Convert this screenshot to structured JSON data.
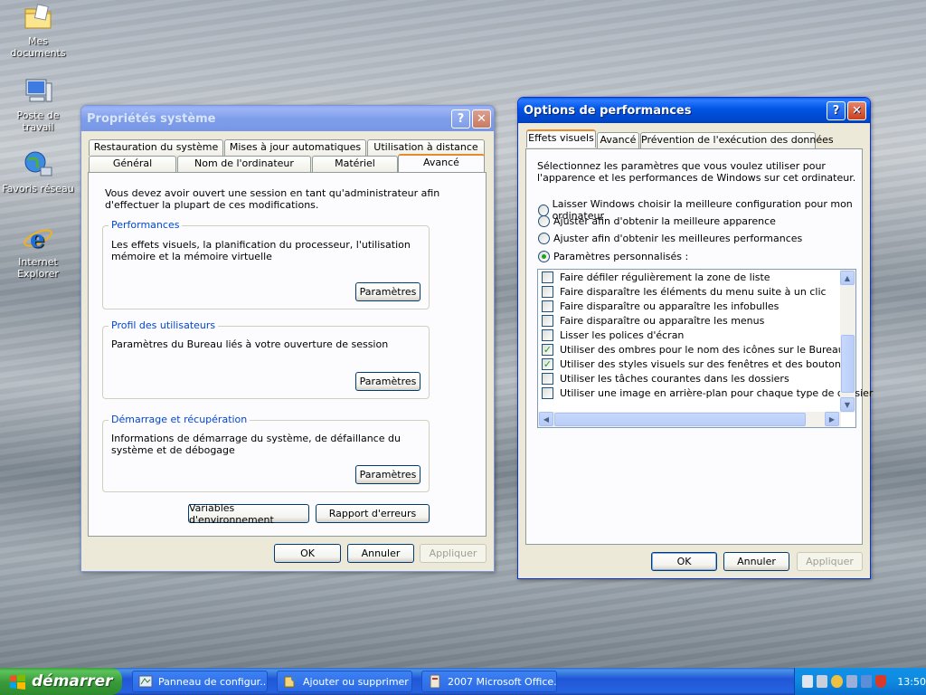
{
  "desktop": {
    "icons": [
      {
        "label": "Mes documents"
      },
      {
        "label": "Poste de travail"
      },
      {
        "label": "Favoris réseau"
      },
      {
        "label": "Internet Explorer"
      }
    ]
  },
  "system_props": {
    "title": "Propriétés système",
    "help": "?",
    "close": "✕",
    "tabs_back": [
      "Restauration du système",
      "Mises à jour automatiques",
      "Utilisation à distance"
    ],
    "tabs_front": [
      "Général",
      "Nom de l'ordinateur",
      "Matériel",
      "Avancé"
    ],
    "intro": "Vous devez avoir ouvert une session en tant qu'administrateur afin d'effectuer la plupart de ces modifications.",
    "groups": [
      {
        "legend": "Performances",
        "text": "Les effets visuels, la planification du processeur, l'utilisation mémoire et la mémoire virtuelle",
        "button": "Paramètres"
      },
      {
        "legend": "Profil des utilisateurs",
        "text": "Paramètres du Bureau liés à votre ouverture de session",
        "button": "Paramètres"
      },
      {
        "legend": "Démarrage et récupération",
        "text": "Informations de démarrage du système, de défaillance du système et de débogage",
        "button": "Paramètres"
      }
    ],
    "env_button": "Variables d'environnement",
    "err_button": "Rapport d'erreurs",
    "ok": "OK",
    "cancel": "Annuler",
    "apply": "Appliquer"
  },
  "perf_options": {
    "title": "Options de performances",
    "help": "?",
    "close": "✕",
    "tabs": [
      "Effets visuels",
      "Avancé",
      "Prévention de l'exécution des données"
    ],
    "description": "Sélectionnez les paramètres que vous voulez utiliser pour l'apparence et les performances de Windows sur cet ordinateur.",
    "radios": [
      {
        "label": "Laisser Windows choisir la meilleure configuration pour mon ordinateur",
        "checked": false
      },
      {
        "label": "Ajuster afin d'obtenir la meilleure apparence",
        "checked": false
      },
      {
        "label": "Ajuster afin d'obtenir les meilleures performances",
        "checked": false
      },
      {
        "label": "Paramètres personnalisés :",
        "checked": true
      }
    ],
    "checkboxes": [
      {
        "label": "Faire défiler régulièrement la zone de liste",
        "checked": false
      },
      {
        "label": "Faire disparaître les éléments du menu suite à un clic",
        "checked": false
      },
      {
        "label": "Faire disparaître ou apparaître les infobulles",
        "checked": false
      },
      {
        "label": "Faire disparaître ou apparaître les menus",
        "checked": false
      },
      {
        "label": "Lisser les polices d'écran",
        "checked": false
      },
      {
        "label": "Utiliser des ombres pour le nom des icônes sur le Bureau",
        "checked": true
      },
      {
        "label": "Utiliser des styles visuels sur des fenêtres et des boutons",
        "checked": true
      },
      {
        "label": "Utiliser les tâches courantes dans les dossiers",
        "checked": false
      },
      {
        "label": "Utiliser une image en arrière-plan pour chaque type de dossier",
        "checked": false
      }
    ],
    "ok": "OK",
    "cancel": "Annuler",
    "apply": "Appliquer"
  },
  "taskbar": {
    "start_label": "démarrer",
    "tasks": [
      {
        "label": "Panneau de configur..."
      },
      {
        "label": "Ajouter ou supprimer ..."
      },
      {
        "label": "2007 Microsoft Office..."
      }
    ],
    "clock": "13:50"
  },
  "colors": {
    "accent": "#0054e3",
    "start": "#3a9c3a",
    "legend": "#0046d5"
  }
}
